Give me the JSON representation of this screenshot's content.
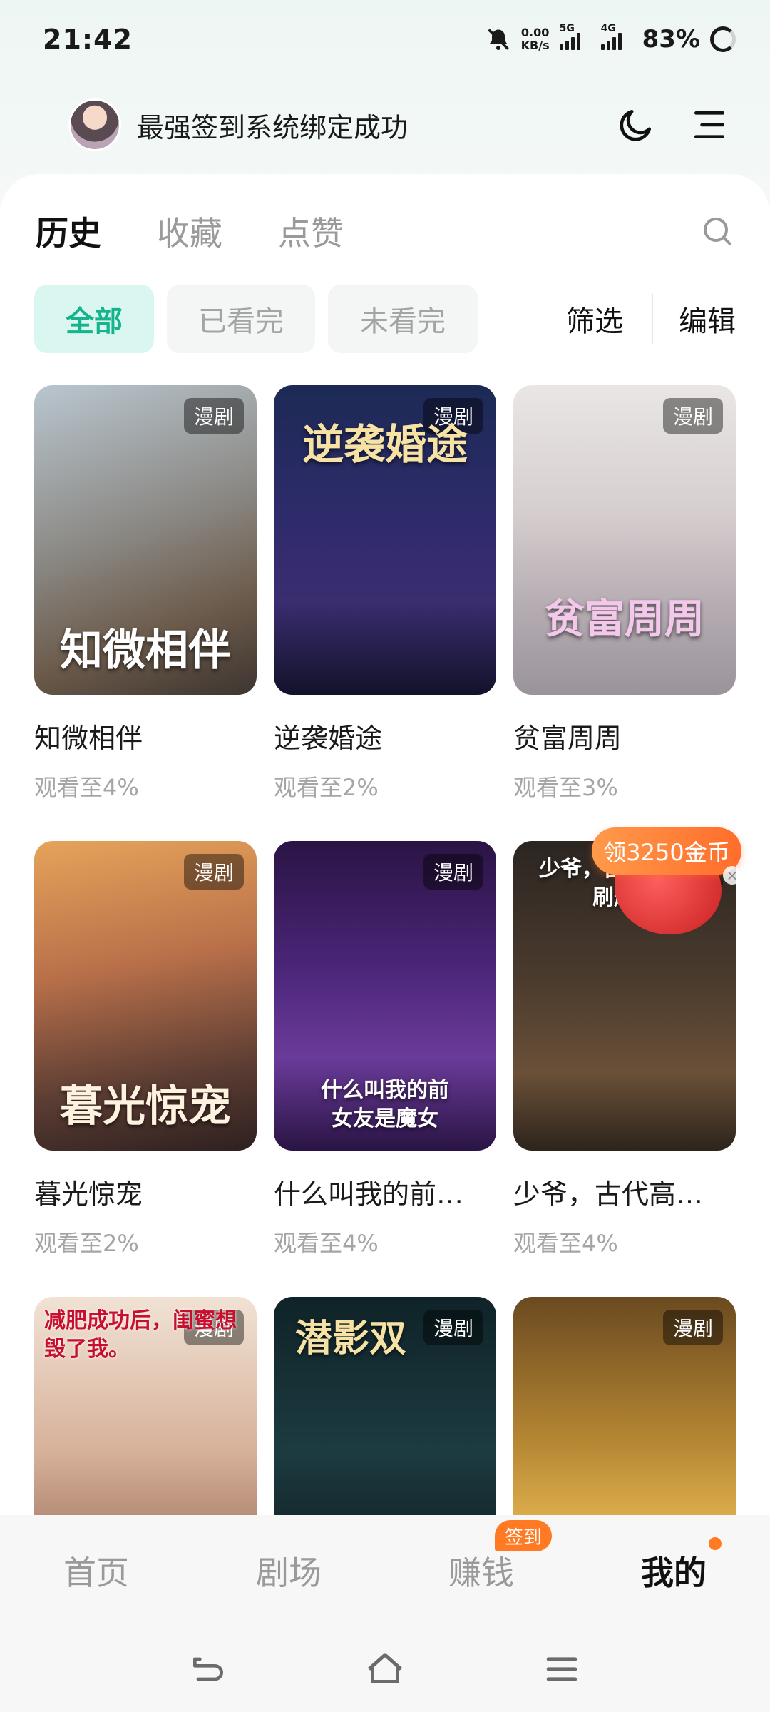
{
  "status_bar": {
    "time": "21:42",
    "net_speed_value": "0.00",
    "net_speed_unit": "KB/s",
    "sim1": "5G",
    "sim2": "4G",
    "battery": "83%"
  },
  "header": {
    "title": "最强签到系统绑定成功",
    "icons": [
      "avatar",
      "moon-icon",
      "menu-icon"
    ]
  },
  "tabs": [
    {
      "label": "历史",
      "active": true
    },
    {
      "label": "收藏",
      "active": false
    },
    {
      "label": "点赞",
      "active": false
    }
  ],
  "filters": {
    "chips": [
      "全部",
      "已看完",
      "未看完"
    ],
    "filter_label": "筛选",
    "edit_label": "编辑"
  },
  "items": [
    {
      "title": "知微相伴",
      "art_title": "知微相伴",
      "tag": "漫剧",
      "progress": "观看至4%"
    },
    {
      "title": "逆袭婚途",
      "art_title": "逆袭婚途",
      "tag": "漫剧",
      "progress": "观看至2%"
    },
    {
      "title": "贫富周周",
      "art_title": "贫富周周",
      "tag": "漫剧",
      "progress": "观看至3%"
    },
    {
      "title": "暮光惊宠",
      "art_title": "暮光惊宠",
      "tag": "漫剧",
      "progress": "观看至2%"
    },
    {
      "title": "什么叫我的前…",
      "art_title": "什么叫我的前女友是魔女",
      "tag": "漫剧",
      "progress": "观看至4%"
    },
    {
      "title": "少爷，古代高…",
      "art_title": "少爷，古代高考该刷题了",
      "tag": "漫剧",
      "progress": "观看至4%"
    },
    {
      "title": "",
      "art_title": "减肥成功后，闺蜜想毁了我。",
      "tag": "漫剧",
      "progress": ""
    },
    {
      "title": "",
      "art_title": "潜影双",
      "tag": "漫剧",
      "progress": ""
    },
    {
      "title": "",
      "art_title": "",
      "tag": "漫剧",
      "progress": ""
    }
  ],
  "promo": {
    "label": "领3250金币",
    "close": "×"
  },
  "bottom_nav": [
    {
      "label": "首页",
      "active": false
    },
    {
      "label": "剧场",
      "active": false
    },
    {
      "label": "赚钱",
      "active": false,
      "badge": "签到"
    },
    {
      "label": "我的",
      "active": true
    }
  ],
  "colors": {
    "accent": "#16b38f",
    "accent_bg": "#d9f7f0",
    "badge": "#ff7a22"
  }
}
